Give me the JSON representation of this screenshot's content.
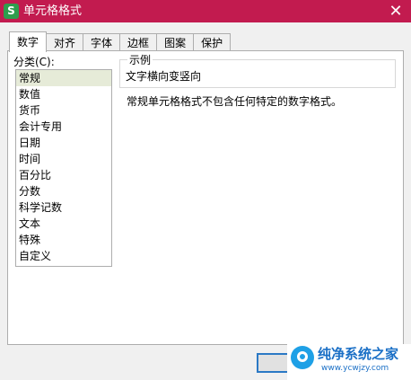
{
  "window": {
    "title": "单元格格式",
    "app_icon_letter": "S",
    "close_glyph": "✕",
    "titlebar_color": "#c21b4f"
  },
  "tabs": [
    {
      "label": "数字",
      "active": true
    },
    {
      "label": "对齐"
    },
    {
      "label": "字体"
    },
    {
      "label": "边框"
    },
    {
      "label": "图案"
    },
    {
      "label": "保护"
    }
  ],
  "category": {
    "label": "分类(C):",
    "selected": "常规",
    "items": [
      "常规",
      "数值",
      "货币",
      "会计专用",
      "日期",
      "时间",
      "百分比",
      "分数",
      "科学记数",
      "文本",
      "特殊",
      "自定义"
    ]
  },
  "sample": {
    "legend": "示例",
    "value": "文字横向变竖向"
  },
  "description": "常规单元格格式不包含任何特定的数字格式。",
  "watermark": {
    "title": "纯净系统之家",
    "url": "www.ycwjzy.com",
    "icon": "logo-icon"
  }
}
